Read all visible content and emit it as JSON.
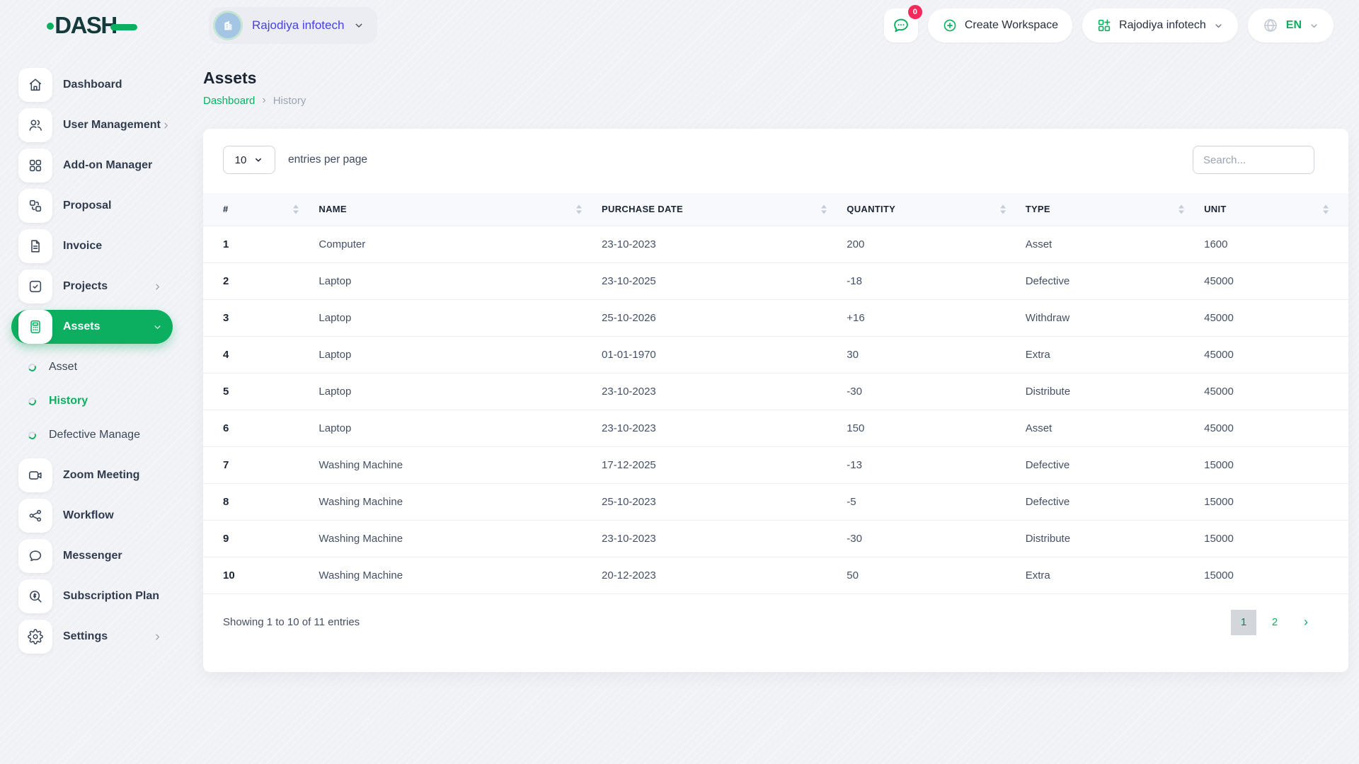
{
  "colors": {
    "primary_green": "#0caf60",
    "logo_dark": "#143a3c",
    "workspace_name_blue": "#4742e0",
    "badge_pink": "#f8285a",
    "header_band": "#f8f9fc",
    "active_page_bg": "#d3d6db",
    "text_dark": "#1b2534",
    "text_body": "#445064",
    "text_muted": "#9aa4b2"
  },
  "topbar": {
    "logo_text": "DASH",
    "workspace_chip": {
      "name": "Rajodiya infotech",
      "icon": "building-icon"
    },
    "messages": {
      "icon": "chat-bubble-icon",
      "badge": "0"
    },
    "create_workspace": {
      "icon": "plus-circle-icon",
      "label": "Create Workspace"
    },
    "workspace_dropdown": {
      "icon": "grid-plus-icon",
      "label": "Rajodiya infotech"
    },
    "language": {
      "icon": "globe-icon",
      "label": "EN"
    }
  },
  "sidebar": {
    "items": [
      {
        "label": "Dashboard",
        "icon": "home-icon",
        "chevron": "none",
        "active": false
      },
      {
        "label": "User Management",
        "icon": "users-icon",
        "chevron": "right",
        "active": false
      },
      {
        "label": "Add-on Manager",
        "icon": "addon-icon",
        "chevron": "none",
        "active": false
      },
      {
        "label": "Proposal",
        "icon": "proposal-icon",
        "chevron": "none",
        "active": false
      },
      {
        "label": "Invoice",
        "icon": "invoice-icon",
        "chevron": "none",
        "active": false
      },
      {
        "label": "Projects",
        "icon": "projects-icon",
        "chevron": "right",
        "active": false
      },
      {
        "label": "Assets",
        "icon": "assets-icon",
        "chevron": "down",
        "active": true,
        "children": [
          {
            "label": "Asset",
            "active": false
          },
          {
            "label": "History",
            "active": true
          },
          {
            "label": "Defective Manage",
            "active": false
          }
        ]
      },
      {
        "label": "Zoom Meeting",
        "icon": "zoom-meeting-icon",
        "chevron": "none",
        "active": false
      },
      {
        "label": "Workflow",
        "icon": "workflow-icon",
        "chevron": "none",
        "active": false
      },
      {
        "label": "Messenger",
        "icon": "messenger-icon",
        "chevron": "none",
        "active": false
      },
      {
        "label": "Subscription Plan",
        "icon": "subscription-plan-icon",
        "chevron": "none",
        "active": false
      },
      {
        "label": "Settings",
        "icon": "settings-icon",
        "chevron": "right",
        "active": false
      }
    ]
  },
  "page": {
    "title": "Assets",
    "breadcrumb": {
      "home": "Dashboard",
      "separator": "›",
      "current": "History"
    }
  },
  "controls": {
    "entries_value": "10",
    "entries_label": "entries per page",
    "search_placeholder": "Search..."
  },
  "table": {
    "columns": [
      "#",
      "NAME",
      "PURCHASE DATE",
      "QUANTITY",
      "TYPE",
      "UNIT"
    ],
    "rows": [
      [
        "1",
        "Computer",
        "23-10-2023",
        "200",
        "Asset",
        "1600"
      ],
      [
        "2",
        "Laptop",
        "23-10-2025",
        "-18",
        "Defective",
        "45000"
      ],
      [
        "3",
        "Laptop",
        "25-10-2026",
        "+16",
        "Withdraw",
        "45000"
      ],
      [
        "4",
        "Laptop",
        "01-01-1970",
        "30",
        "Extra",
        "45000"
      ],
      [
        "5",
        "Laptop",
        "23-10-2023",
        "-30",
        "Distribute",
        "45000"
      ],
      [
        "6",
        "Laptop",
        "23-10-2023",
        "150",
        "Asset",
        "45000"
      ],
      [
        "7",
        "Washing Machine",
        "17-12-2025",
        "-13",
        "Defective",
        "15000"
      ],
      [
        "8",
        "Washing Machine",
        "25-10-2023",
        "-5",
        "Defective",
        "15000"
      ],
      [
        "9",
        "Washing Machine",
        "23-10-2023",
        "-30",
        "Distribute",
        "15000"
      ],
      [
        "10",
        "Washing Machine",
        "20-12-2023",
        "50",
        "Extra",
        "15000"
      ]
    ]
  },
  "footer": {
    "summary": "Showing 1 to 10 of 11 entries",
    "pages": [
      "1",
      "2"
    ],
    "active_page": "1",
    "next": "›"
  }
}
